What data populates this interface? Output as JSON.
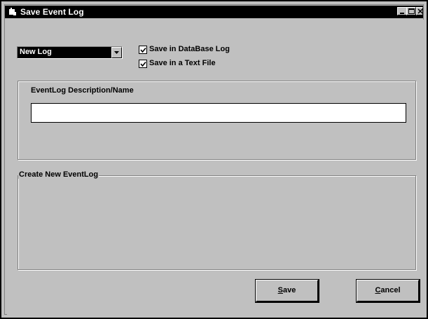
{
  "window": {
    "title": "Save Event Log",
    "controls": {
      "minimize": "minimize",
      "maximize": "maximize",
      "close": "close"
    }
  },
  "log_select": {
    "value": "New Log"
  },
  "options": {
    "save_db": {
      "label": "Save in DataBase Log",
      "checked": true
    },
    "save_text": {
      "label": "Save in a Text File",
      "checked": true
    }
  },
  "description_group": {
    "label": "EventLog Description/Name",
    "value": ""
  },
  "create_group": {
    "label": "Create New EventLog"
  },
  "buttons": {
    "save": {
      "accel": "S",
      "rest": "ave"
    },
    "cancel": {
      "accel": "C",
      "rest": "ancel"
    }
  },
  "colors": {
    "titlebar": "#000000",
    "face": "#c0c0c0"
  }
}
